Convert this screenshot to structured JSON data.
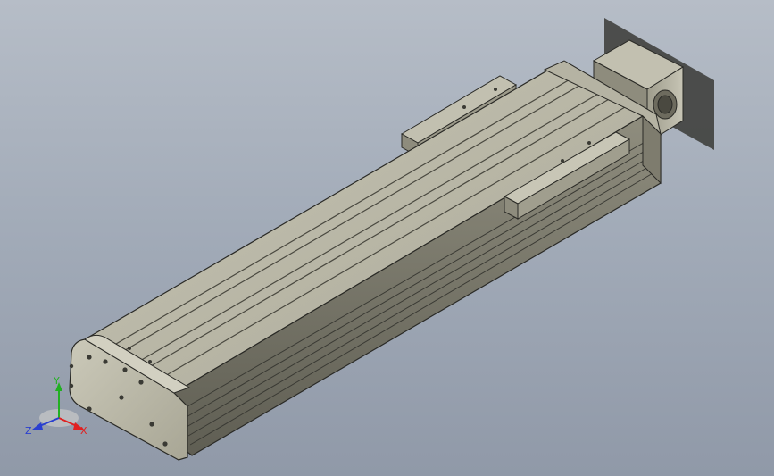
{
  "triad": {
    "x_label": "X",
    "y_label": "Y",
    "z_label": "Z",
    "x_color": "#e02020",
    "y_color": "#22b022",
    "z_color": "#2a3fd0"
  },
  "colors": {
    "background_top": "#b6bdc7",
    "background_bottom": "#9099a8",
    "body_face": "#b9b7a6",
    "body_dark": "#6d6c60",
    "edge_line": "#2a2a26"
  },
  "model": {
    "icon": "linear-actuator-model"
  }
}
